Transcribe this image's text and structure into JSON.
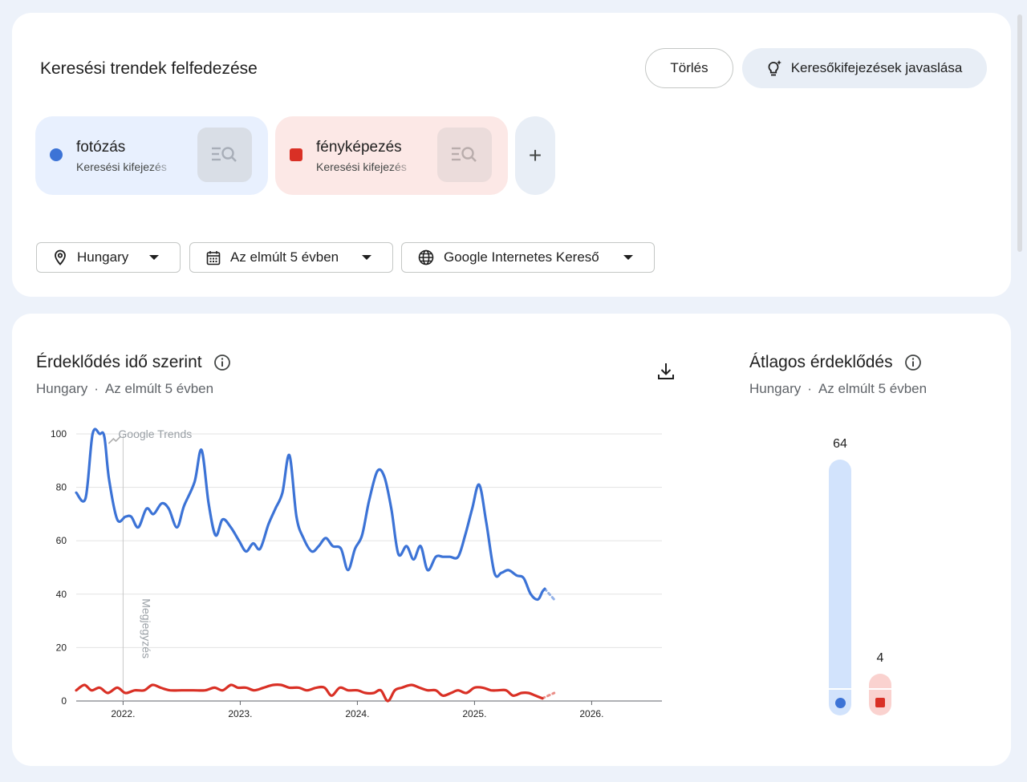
{
  "explore": {
    "title": "Keresési trendek felfedezése",
    "clear_label": "Törlés",
    "suggest_label": "Keresőkifejezések javaslása"
  },
  "terms": [
    {
      "name": "fotózás",
      "type": "Keresési kifejezés",
      "color": "#3c73d6"
    },
    {
      "name": "fényképezés",
      "type": "Keresési kifejezés",
      "color": "#d93025"
    }
  ],
  "add_term_label": "+",
  "filters": {
    "geo": "Hungary",
    "time": "Az elmúlt 5 évben",
    "property": "Google Internetes Kereső"
  },
  "interest_over_time": {
    "title": "Érdeklődés idő szerint",
    "geo": "Hungary",
    "separator": "·",
    "time": "Az elmúlt 5 évben"
  },
  "average_interest": {
    "title": "Átlagos érdeklődés",
    "geo": "Hungary",
    "separator": "·",
    "time": "Az elmúlt 5 évben",
    "values": [
      64,
      4
    ],
    "value_labels": [
      "64",
      "4"
    ]
  },
  "chart_data": {
    "type": "line",
    "watermark": "Google Trends",
    "annotation": "Megjegyzés",
    "ylim": [
      0,
      100
    ],
    "yticks": [
      "0",
      "20",
      "40",
      "60",
      "80",
      "100"
    ],
    "xticks": [
      "2022.",
      "2023.",
      "2024.",
      "2025.",
      "2026."
    ],
    "xlim": [
      2021.6,
      2026.6
    ],
    "grid": true,
    "series": [
      {
        "name": "fotózás",
        "color": "#3c73d6",
        "points": [
          [
            2021.6,
            78
          ],
          [
            2021.68,
            76
          ],
          [
            2021.74,
            100
          ],
          [
            2021.8,
            100
          ],
          [
            2021.84,
            99
          ],
          [
            2021.88,
            83
          ],
          [
            2021.95,
            68
          ],
          [
            2022.02,
            69
          ],
          [
            2022.07,
            69
          ],
          [
            2022.13,
            65
          ],
          [
            2022.2,
            72
          ],
          [
            2022.26,
            70
          ],
          [
            2022.33,
            74
          ],
          [
            2022.39,
            72
          ],
          [
            2022.46,
            65
          ],
          [
            2022.52,
            73
          ],
          [
            2022.61,
            82
          ],
          [
            2022.67,
            94
          ],
          [
            2022.73,
            74
          ],
          [
            2022.79,
            62
          ],
          [
            2022.85,
            68
          ],
          [
            2022.92,
            65
          ],
          [
            2022.99,
            60
          ],
          [
            2023.05,
            56
          ],
          [
            2023.11,
            59
          ],
          [
            2023.17,
            57
          ],
          [
            2023.24,
            66
          ],
          [
            2023.3,
            72
          ],
          [
            2023.36,
            78
          ],
          [
            2023.42,
            92
          ],
          [
            2023.48,
            69
          ],
          [
            2023.54,
            61
          ],
          [
            2023.61,
            56
          ],
          [
            2023.67,
            58
          ],
          [
            2023.73,
            61
          ],
          [
            2023.79,
            58
          ],
          [
            2023.86,
            57
          ],
          [
            2023.92,
            49
          ],
          [
            2023.98,
            57
          ],
          [
            2024.04,
            62
          ],
          [
            2024.1,
            75
          ],
          [
            2024.17,
            86
          ],
          [
            2024.23,
            84
          ],
          [
            2024.29,
            72
          ],
          [
            2024.35,
            55
          ],
          [
            2024.42,
            58
          ],
          [
            2024.48,
            53
          ],
          [
            2024.54,
            58
          ],
          [
            2024.6,
            49
          ],
          [
            2024.67,
            54
          ],
          [
            2024.73,
            54
          ],
          [
            2024.79,
            54
          ],
          [
            2024.86,
            54
          ],
          [
            2024.92,
            62
          ],
          [
            2024.98,
            72
          ],
          [
            2025.04,
            81
          ],
          [
            2025.1,
            67
          ],
          [
            2025.17,
            48
          ],
          [
            2025.23,
            48
          ],
          [
            2025.29,
            49
          ],
          [
            2025.36,
            47
          ],
          [
            2025.42,
            46
          ],
          [
            2025.48,
            40
          ],
          [
            2025.54,
            38
          ],
          [
            2025.58,
            41
          ],
          [
            2025.6,
            42
          ]
        ],
        "partial": [
          [
            2025.6,
            42
          ],
          [
            2025.64,
            40
          ],
          [
            2025.68,
            38
          ]
        ]
      },
      {
        "name": "fényképezés",
        "color": "#d93025",
        "points": [
          [
            2021.6,
            4
          ],
          [
            2021.67,
            6
          ],
          [
            2021.73,
            4
          ],
          [
            2021.8,
            5
          ],
          [
            2021.87,
            3
          ],
          [
            2021.95,
            5
          ],
          [
            2022.02,
            3
          ],
          [
            2022.1,
            4
          ],
          [
            2022.18,
            4
          ],
          [
            2022.25,
            6
          ],
          [
            2022.32,
            5
          ],
          [
            2022.4,
            4
          ],
          [
            2022.5,
            4
          ],
          [
            2022.6,
            4
          ],
          [
            2022.7,
            4
          ],
          [
            2022.78,
            5
          ],
          [
            2022.85,
            4
          ],
          [
            2022.92,
            6
          ],
          [
            2022.98,
            5
          ],
          [
            2023.05,
            5
          ],
          [
            2023.12,
            4
          ],
          [
            2023.2,
            5
          ],
          [
            2023.28,
            6
          ],
          [
            2023.35,
            6
          ],
          [
            2023.42,
            5
          ],
          [
            2023.5,
            5
          ],
          [
            2023.57,
            4
          ],
          [
            2023.65,
            5
          ],
          [
            2023.72,
            5
          ],
          [
            2023.78,
            2
          ],
          [
            2023.85,
            5
          ],
          [
            2023.92,
            4
          ],
          [
            2024.0,
            4
          ],
          [
            2024.07,
            3
          ],
          [
            2024.14,
            3
          ],
          [
            2024.2,
            4
          ],
          [
            2024.26,
            0
          ],
          [
            2024.32,
            4
          ],
          [
            2024.38,
            5
          ],
          [
            2024.46,
            6
          ],
          [
            2024.53,
            5
          ],
          [
            2024.6,
            4
          ],
          [
            2024.67,
            4
          ],
          [
            2024.73,
            2
          ],
          [
            2024.8,
            3
          ],
          [
            2024.86,
            4
          ],
          [
            2024.93,
            3
          ],
          [
            2025.0,
            5
          ],
          [
            2025.07,
            5
          ],
          [
            2025.14,
            4
          ],
          [
            2025.2,
            4
          ],
          [
            2025.27,
            4
          ],
          [
            2025.33,
            2
          ],
          [
            2025.4,
            3
          ],
          [
            2025.46,
            3
          ],
          [
            2025.52,
            2
          ],
          [
            2025.58,
            1
          ]
        ],
        "partial": [
          [
            2025.58,
            1
          ],
          [
            2025.63,
            2
          ],
          [
            2025.68,
            3
          ]
        ]
      }
    ]
  }
}
